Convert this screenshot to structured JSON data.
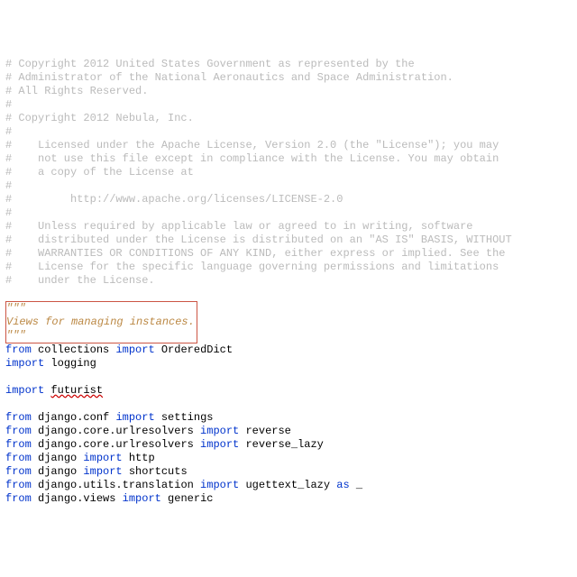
{
  "license_comments": [
    "# Copyright 2012 United States Government as represented by the",
    "# Administrator of the National Aeronautics and Space Administration.",
    "# All Rights Reserved.",
    "#",
    "# Copyright 2012 Nebula, Inc.",
    "#",
    "#    Licensed under the Apache License, Version 2.0 (the \"License\"); you may",
    "#    not use this file except in compliance with the License. You may obtain",
    "#    a copy of the License at",
    "#",
    "#         http://www.apache.org/licenses/LICENSE-2.0",
    "#",
    "#    Unless required by applicable law or agreed to in writing, software",
    "#    distributed under the License is distributed on an \"AS IS\" BASIS, WITHOUT",
    "#    WARRANTIES OR CONDITIONS OF ANY KIND, either express or implied. See the",
    "#    License for the specific language governing permissions and limitations",
    "#    under the License."
  ],
  "docstring": {
    "open": "\"\"\"",
    "body": "Views for managing instances.",
    "close": "\"\"\""
  },
  "kw": {
    "from": "from",
    "import": "import",
    "as": "as"
  },
  "code": {
    "l1_mod": " collections ",
    "l1_name": " OrderedDict",
    "l2_name": " logging",
    "l3_name": " futurist",
    "l4_mod": " django.conf ",
    "l4_name": " settings",
    "l5_mod": " django.core.urlresolvers ",
    "l5_name": " reverse",
    "l6_mod": " django.core.urlresolvers ",
    "l6_name": " reverse_lazy",
    "l7_mod": " django ",
    "l7_name": " http",
    "l8_mod": " django ",
    "l8_name": " shortcuts",
    "l9_mod": " django.utils.translation ",
    "l9_name": " ugettext_lazy ",
    "l9_alias": " _",
    "l10_mod": " django.views ",
    "l10_name": " generic"
  }
}
